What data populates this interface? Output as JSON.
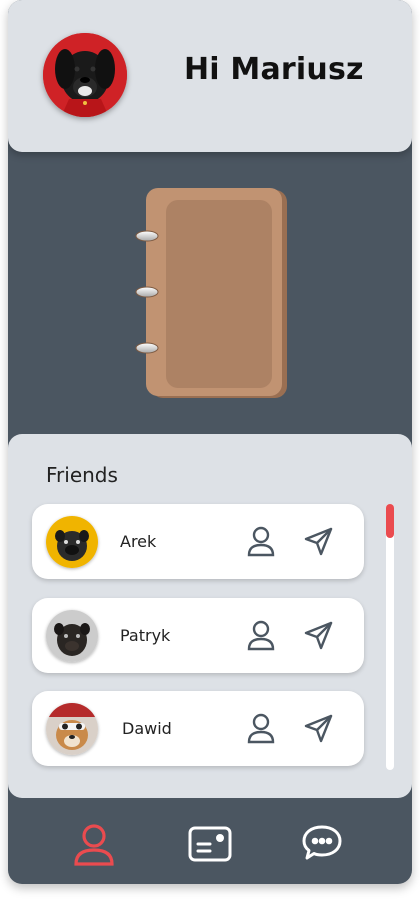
{
  "header": {
    "greeting": "Hi Mariusz",
    "avatar_icon": "dog-avatar-icon"
  },
  "friends": {
    "title": "Friends",
    "items": [
      {
        "name": "Arek",
        "avatar_bg": "#f0b400"
      },
      {
        "name": "Patryk",
        "avatar_bg": "#cccccc"
      },
      {
        "name": "Dawid",
        "avatar_bg": "#d9d0c8"
      }
    ],
    "scroll_position": 0
  },
  "nav": {
    "items": [
      "profile-icon",
      "id-card-icon",
      "chat-bubble-icon"
    ],
    "active": "profile-icon"
  },
  "colors": {
    "background": "#4b5661",
    "panel": "#dde1e6",
    "accent": "#ea4b4f",
    "notebook": "#c19372"
  }
}
